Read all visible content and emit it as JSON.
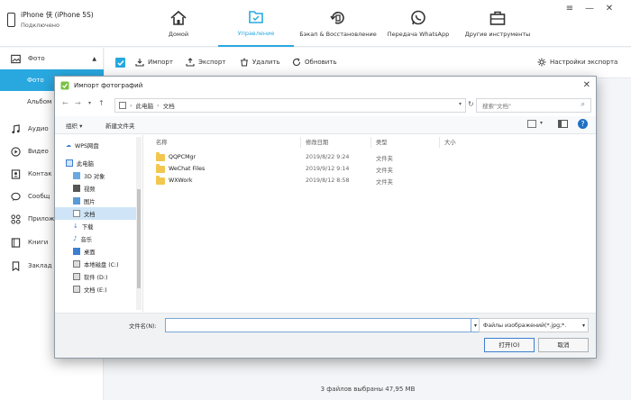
{
  "device": {
    "name": "iPhone 侠 (iPhone 5S)",
    "status": "Подключено"
  },
  "nav": {
    "home": "Домой",
    "manage": "Управление",
    "backup": "Бэкап & Восстановление",
    "whatsapp": "Передача WhatsApp",
    "tools": "Другие инструменты"
  },
  "sidebar": {
    "items": [
      {
        "label": "Фото"
      },
      {
        "label": "Фото"
      },
      {
        "label": "Альбом"
      },
      {
        "label": "Аудио"
      },
      {
        "label": "Видео"
      },
      {
        "label": "Контак"
      },
      {
        "label": "Сообщ"
      },
      {
        "label": "Прилож"
      },
      {
        "label": "Книги"
      },
      {
        "label": "Заклад"
      }
    ]
  },
  "toolbar": {
    "import": "Импорт",
    "export": "Экспорт",
    "delete": "Удалить",
    "refresh": "Обновить",
    "export_settings": "Настройки экспорта"
  },
  "footer": {
    "status": "3 файлов выбраны 47,95 MB"
  },
  "dialog": {
    "title": "Импорт фотографий",
    "path": [
      "此电脑",
      "文档"
    ],
    "search_placeholder": "搜索\"文档\"",
    "organize": "组织 ▾",
    "new_folder": "新建文件夹",
    "nav": [
      "WPS网盘",
      "此电脑",
      "3D 对象",
      "视频",
      "图片",
      "文档",
      "下载",
      "音乐",
      "桌面",
      "本地磁盘 (C:)",
      "软件 (D:)",
      "文档 (E:)"
    ],
    "columns": {
      "name": "名称",
      "modified": "修改日期",
      "type": "类型",
      "size": "大小"
    },
    "files": [
      {
        "name": "QQPCMgr",
        "modified": "2019/8/22 9:24",
        "type": "文件夹"
      },
      {
        "name": "WeChat Files",
        "modified": "2019/9/12 9:14",
        "type": "文件夹"
      },
      {
        "name": "WXWork",
        "modified": "2019/8/12 8:58",
        "type": "文件夹"
      }
    ],
    "filename_label": "文件名(N):",
    "filename_value": "",
    "filter": "Файлы изображений(*.jpg;*.",
    "open": "打开(O)",
    "cancel": "取消"
  },
  "colors": {
    "accent": "#29a8e0",
    "folder": "#f3c74f"
  }
}
